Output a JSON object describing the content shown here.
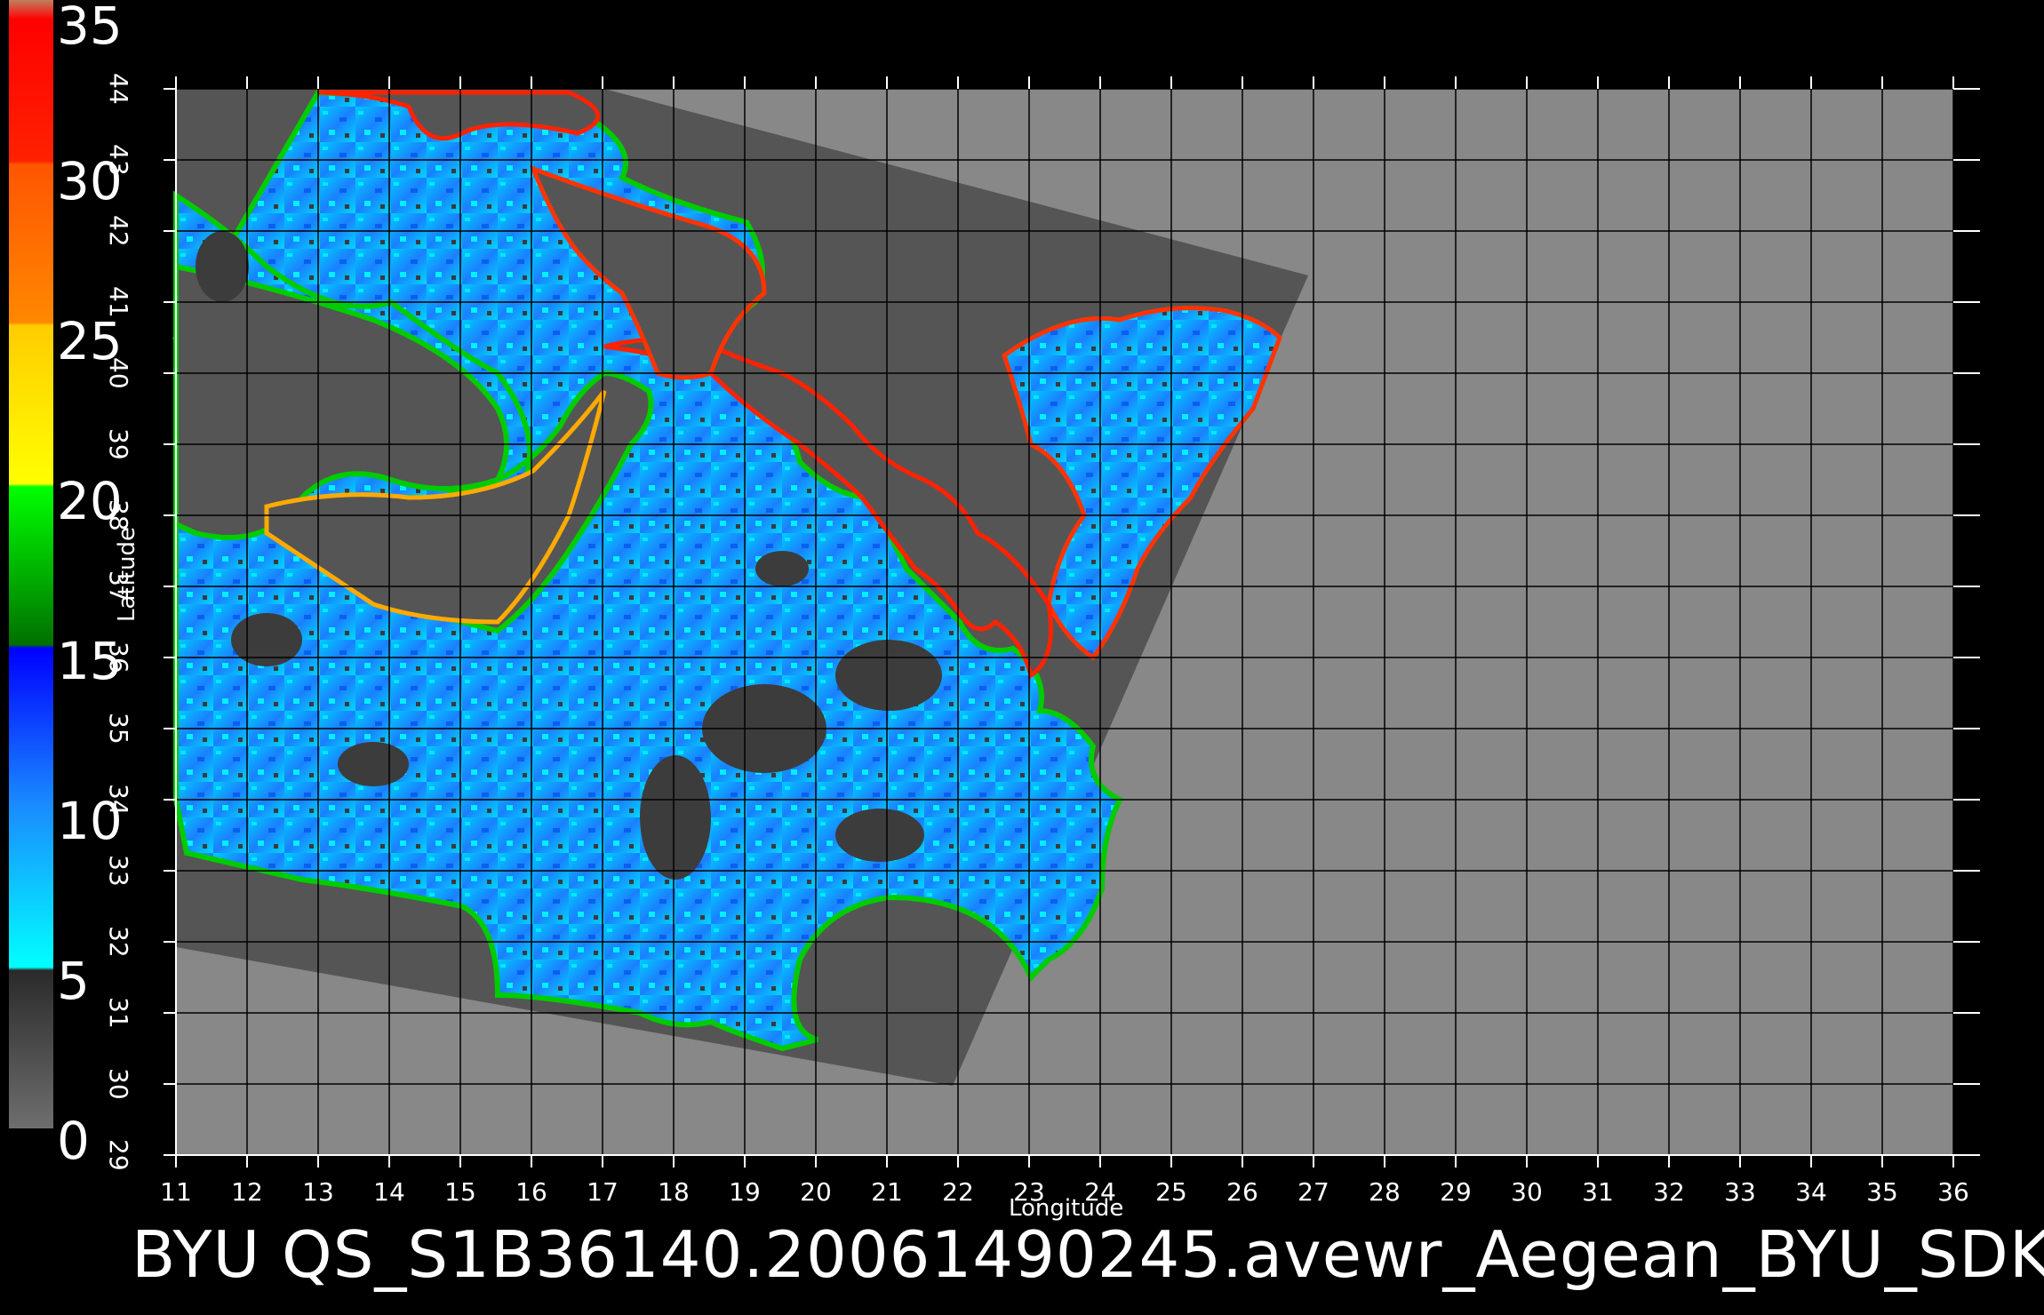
{
  "title": "BYU  QS_S1B36140.20061490245.avewr_Aegean_BYU_SDK",
  "axes": {
    "xlabel": "Longitude",
    "ylabel": "Latitude",
    "x_ticks": [
      "11",
      "12",
      "13",
      "14",
      "15",
      "16",
      "17",
      "18",
      "19",
      "20",
      "21",
      "22",
      "23",
      "24",
      "25",
      "26",
      "27",
      "28",
      "29",
      "30",
      "31",
      "32",
      "33",
      "34",
      "35",
      "36"
    ],
    "y_ticks": [
      "29",
      "30",
      "31",
      "32",
      "33",
      "34",
      "35",
      "36",
      "37",
      "38",
      "39",
      "40",
      "41",
      "42",
      "43",
      "44"
    ],
    "xlim": [
      11,
      36
    ],
    "ylim": [
      29,
      44
    ]
  },
  "colorbar": {
    "labels": [
      "35",
      "30",
      "25",
      "20",
      "15",
      "10",
      "5",
      "0"
    ],
    "range": [
      0,
      35
    ],
    "stops": [
      {
        "value": 0,
        "color": "#6e6e6e"
      },
      {
        "value": 4.9,
        "color": "#2a2a2a"
      },
      {
        "value": 5,
        "color": "#00ffff"
      },
      {
        "value": 10,
        "color": "#1a8cff"
      },
      {
        "value": 14.9,
        "color": "#0000ff"
      },
      {
        "value": 15,
        "color": "#007000"
      },
      {
        "value": 19.9,
        "color": "#00ff00"
      },
      {
        "value": 20,
        "color": "#ffff00"
      },
      {
        "value": 24.9,
        "color": "#ffcc00"
      },
      {
        "value": 25,
        "color": "#ff8800"
      },
      {
        "value": 29.9,
        "color": "#ff5500"
      },
      {
        "value": 30,
        "color": "#ff2200"
      },
      {
        "value": 34.4,
        "color": "#ff0000"
      },
      {
        "value": 35,
        "color": "#c08060"
      }
    ]
  },
  "colors": {
    "background": "#000000",
    "land_outside": "#888888",
    "swath_nodata": "#555555",
    "ocean_low": "#00e5ff",
    "ocean_mid": "#1a7cff",
    "coast_high": "#00cc00",
    "grid": "#000000"
  }
}
